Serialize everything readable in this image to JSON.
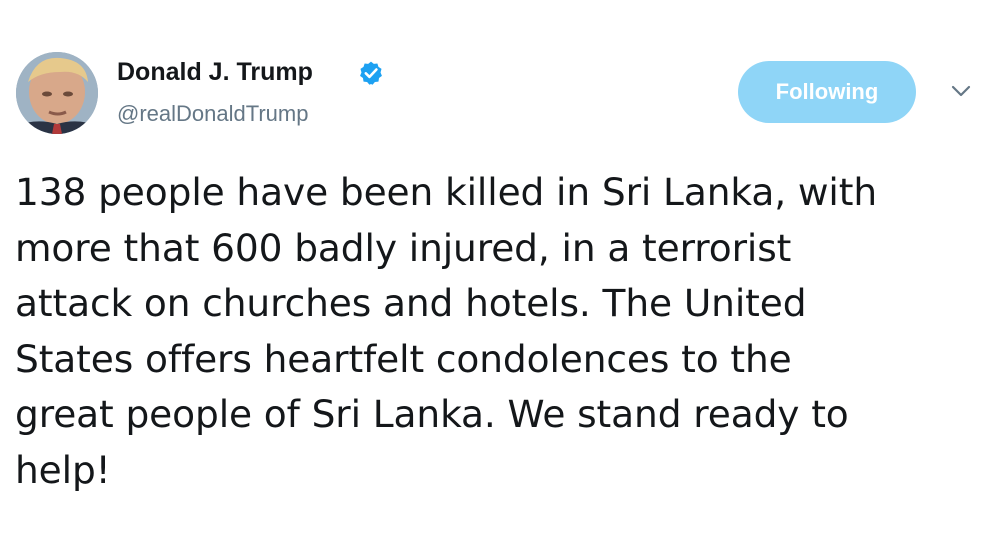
{
  "author": {
    "display_name": "Donald J. Trump",
    "handle": "@realDonaldTrump",
    "verified": true,
    "avatar_icon": "profile-photo"
  },
  "actions": {
    "follow_label": "Following",
    "more_icon": "chevron-down-icon"
  },
  "tweet": {
    "lines": [
      "138 people have been killed in Sri Lanka, with",
      "more that 600 badly injured, in a terrorist",
      "attack on churches and hotels. The United",
      "States offers heartfelt condolences to the",
      "great people of Sri Lanka. We stand ready to",
      "help!"
    ]
  },
  "colors": {
    "follow_button_bg": "#8fd5f7",
    "verified_badge": "#1da1f2",
    "handle_text": "#657786",
    "body_text": "#14171a"
  }
}
